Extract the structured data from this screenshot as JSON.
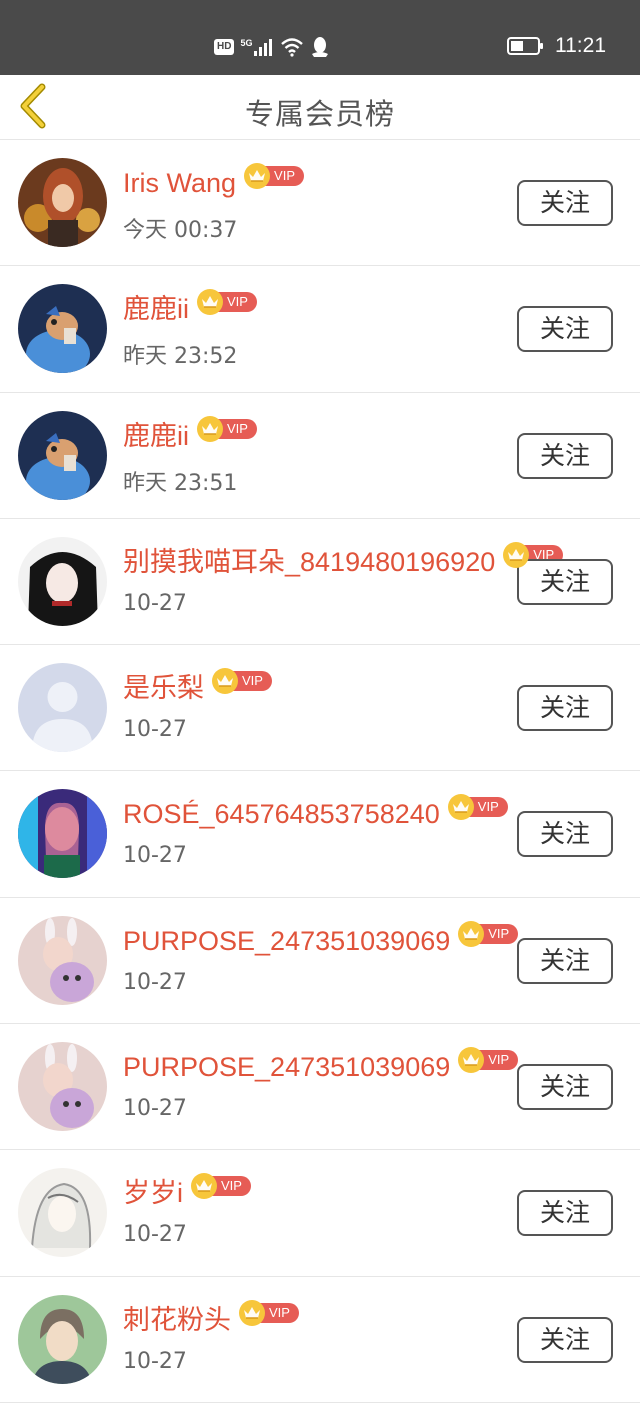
{
  "status_bar": {
    "hd": "HD",
    "network": "5G",
    "time": "11:21"
  },
  "header": {
    "title": "专属会员榜"
  },
  "colors": {
    "accent_name": "#e0533a",
    "vip_tag": "#e65c55",
    "crown": "#f7c63b"
  },
  "vip_label": "VIP",
  "follow_label": "关注",
  "members": [
    {
      "name": "Iris Wang",
      "time": "今天 00:37",
      "avatar": "avatar-photo-woman"
    },
    {
      "name": "鹿鹿ii",
      "time": "昨天 23:52",
      "avatar": "avatar-dog-blue"
    },
    {
      "name": "鹿鹿ii",
      "time": "昨天 23:51",
      "avatar": "avatar-dog-blue"
    },
    {
      "name": "别摸我喵耳朵_8419480196920",
      "time": "10-27",
      "avatar": "avatar-anime-dark"
    },
    {
      "name": "是乐梨",
      "time": "10-27",
      "avatar": "avatar-default-person"
    },
    {
      "name": "ROSÉ_645764853758240",
      "time": "10-27",
      "avatar": "avatar-photo-neon"
    },
    {
      "name": "PURPOSE_247351039069",
      "time": "10-27",
      "avatar": "avatar-photo-bunny"
    },
    {
      "name": "PURPOSE_247351039069",
      "time": "10-27",
      "avatar": "avatar-photo-bunny"
    },
    {
      "name": "岁岁i",
      "time": "10-27",
      "avatar": "avatar-anime-sketch"
    },
    {
      "name": "刺花粉头",
      "time": "10-27",
      "avatar": "avatar-anime-green"
    }
  ]
}
